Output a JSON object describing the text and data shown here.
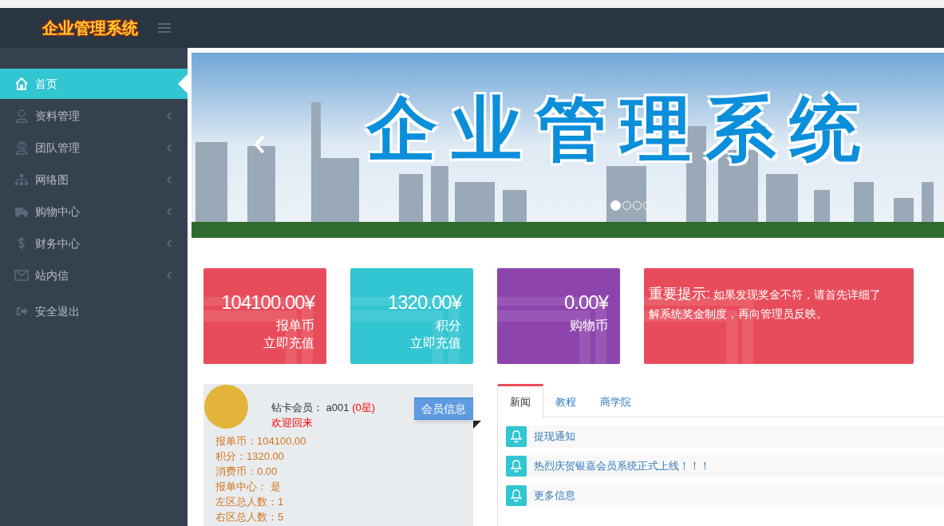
{
  "header": {
    "logo": "企业管理系统"
  },
  "sidebar": {
    "items": [
      {
        "label": "首页",
        "selected": true,
        "expandable": false
      },
      {
        "label": "资料管理",
        "selected": false,
        "expandable": true
      },
      {
        "label": "团队管理",
        "selected": false,
        "expandable": true
      },
      {
        "label": "网络图",
        "selected": false,
        "expandable": true
      },
      {
        "label": "购物中心",
        "selected": false,
        "expandable": true
      },
      {
        "label": "财务中心",
        "selected": false,
        "expandable": true
      },
      {
        "label": "站内信",
        "selected": false,
        "expandable": true
      },
      {
        "label": "安全退出",
        "selected": false,
        "expandable": false
      }
    ]
  },
  "banner": {
    "title": "企业管理系统",
    "slides": [
      {
        "selected": true
      },
      {
        "selected": false
      },
      {
        "selected": false
      },
      {
        "selected": false
      }
    ]
  },
  "stat_cards": [
    {
      "value": "104100.00¥",
      "label": "报单币",
      "link": "立即充值",
      "color": "#e84c5a"
    },
    {
      "value": "1320.00¥",
      "label": "积分",
      "link": "立即充值",
      "color": "#32c5d2"
    },
    {
      "value": "0.00¥",
      "label": "购物币",
      "color": "#8e44ad"
    }
  ],
  "notice": {
    "title": "重要提示:",
    "text": "如果发现奖金不符，请首先详细了解系统奖金制度，再向管理员反映。",
    "color": "#e84c5a"
  },
  "member": {
    "level_label": "钻卡会员：",
    "user": "a001",
    "stars": "(0星)",
    "welcome": "欢迎回来",
    "button": "会员信息",
    "details": [
      "报单币：104100.00",
      "积分：1320.00",
      "消费币：0.00",
      "报单中心： 是",
      "左区总人数：1",
      "右区总人数：5"
    ]
  },
  "news": {
    "tabs": [
      {
        "label": "新闻",
        "selected": true
      },
      {
        "label": "教程",
        "selected": false
      },
      {
        "label": "商学院",
        "selected": false
      }
    ],
    "items": [
      "提现通知",
      "热烈庆贺银嘉会员系统正式上线！！！",
      "更多信息"
    ]
  }
}
